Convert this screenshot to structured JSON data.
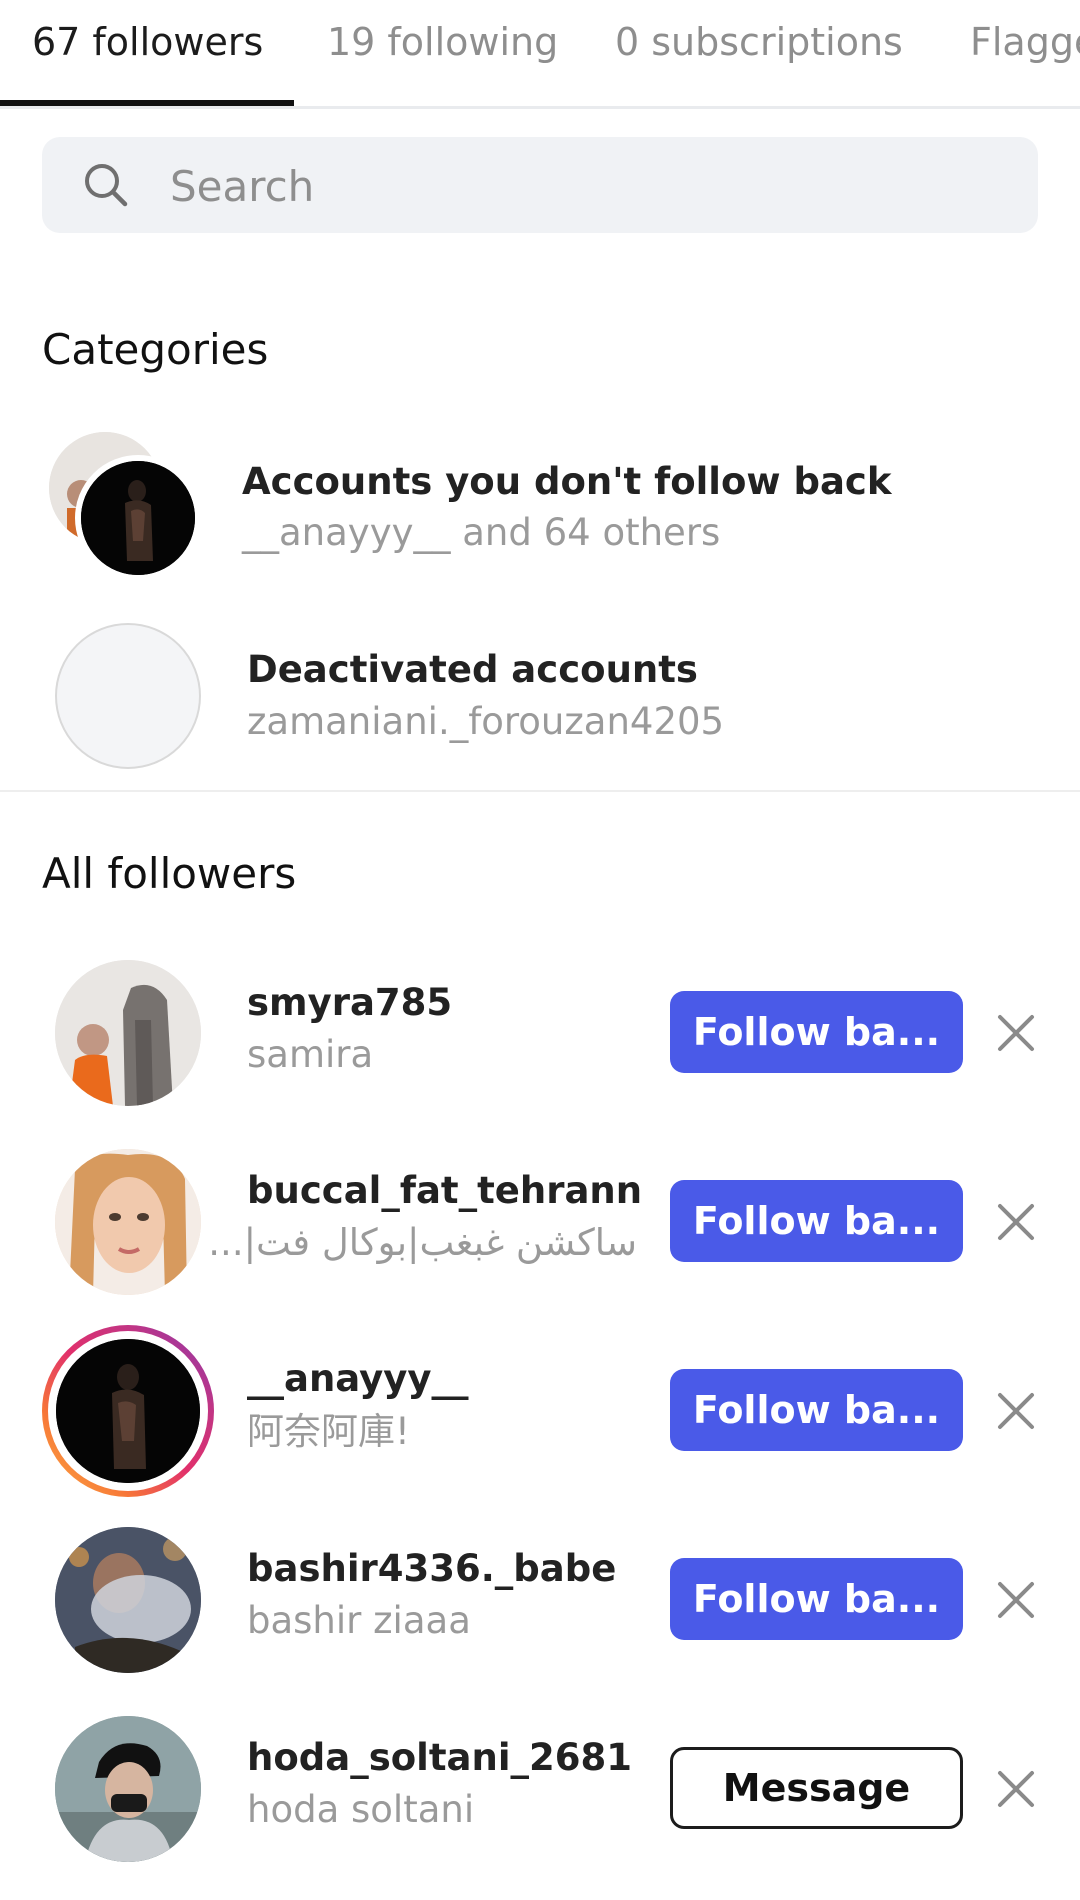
{
  "tabs": [
    {
      "label": "67 followers",
      "active": true
    },
    {
      "label": "19 following",
      "active": false
    },
    {
      "label": "0 subscriptions",
      "active": false
    },
    {
      "label": "Flagge",
      "active": false
    }
  ],
  "search": {
    "placeholder": "Search",
    "icon": "search-icon"
  },
  "categories": {
    "title": "Categories",
    "items": [
      {
        "title": "Accounts you don't follow back",
        "subtitle": "__anayyy__ and 64 others"
      },
      {
        "title": "Deactivated accounts",
        "subtitle": "zamaniani._forouzan4205"
      }
    ]
  },
  "all_followers": {
    "title": "All followers",
    "items": [
      {
        "username": "smyra785",
        "name": "samira",
        "action": "Follow ba...",
        "action_type": "primary"
      },
      {
        "username": "buccal_fat_tehrann",
        "name": "ساکشن غبغب|بوکال فت|...",
        "action": "Follow ba...",
        "action_type": "primary"
      },
      {
        "username": "__anayyy__",
        "name": "阿奈阿庫!",
        "action": "Follow ba...",
        "action_type": "primary"
      },
      {
        "username": "bashir4336._babe",
        "name": "bashir ziaaa",
        "action": "Follow ba...",
        "action_type": "primary"
      },
      {
        "username": "hoda_soltani_2681",
        "name": "hoda soltani",
        "action": "Message",
        "action_type": "secondary"
      }
    ]
  },
  "colors": {
    "accent": "#4a5ae8",
    "muted_text": "#9a9a9a",
    "search_bg": "#f0f2f5"
  }
}
